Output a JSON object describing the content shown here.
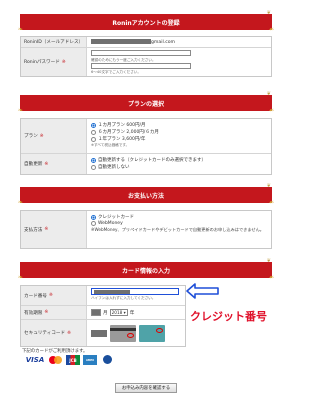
{
  "registration": {
    "header": "Roninアカウントの登録",
    "rows": [
      {
        "label": "RoninID（メールアドレス）",
        "required": false,
        "email_domain": "gmail.com"
      },
      {
        "label": "Roninパスワード",
        "required": true,
        "note1": "確認のためにもう一度ご入力ください。",
        "note2": "6～40文字でご入力ください。"
      }
    ]
  },
  "plan": {
    "header": "プランの選択",
    "plan_label": "プラン",
    "options": [
      "１カ月プラン 600円/月",
      "６カ月プラン 2,000円/６カ月",
      "１年プラン 3,600円/年"
    ],
    "tax_note": "※すべて税込価格です。",
    "auto_label": "自動更新",
    "auto_options": [
      "自動更新する（クレジットカードのみ選択できます）",
      "自動更新しない"
    ]
  },
  "payment": {
    "header": "お支払い方法",
    "label": "支払方法",
    "options": [
      "クレジットカード",
      "WebMoney"
    ],
    "note": "※WebMoney、プリペイドカードやデビットカードで自動更新のお申し込みはできません。"
  },
  "card": {
    "header": "カード情報の入力",
    "number_label": "カード番号",
    "number_note": "ハイフンは入れずに入力してください。",
    "expiry_label": "有効期限",
    "month_unit": "月",
    "year_value": "2018",
    "year_unit": "年",
    "security_label": "セキュリティコード",
    "annotation": "クレジット番号"
  },
  "accepted": {
    "title": "下記のカードがご利用頂けます。",
    "brands": [
      "VISA",
      "MasterCard",
      "JCB",
      "AMERICAN EXPRESS",
      "Diners Club"
    ]
  },
  "confirm_button": "お申込み内容を確認する",
  "colors": {
    "header_red": "#c4171d",
    "annotation_red": "#e0102a",
    "annotation_blue": "#1f4fd8"
  }
}
